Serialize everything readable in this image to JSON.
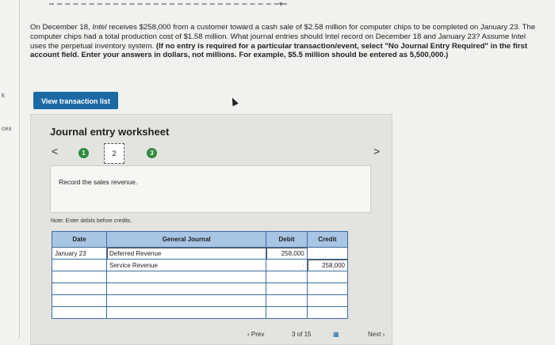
{
  "left_rail": {
    "marks": [
      "k",
      "ces"
    ]
  },
  "question": {
    "part1": "On December 18, ",
    "company_italic": "Intel",
    "part2": " receives $258,000 from a customer toward a cash sale of $2.58 million for computer chips to be completed on January 23. The computer chips had a total production cost of $1.58 million. What journal entries should Intel record on December 18 and January 23? Assume Intel uses the perpetual inventory system. ",
    "bold_instructions": "(If no entry is required for a particular transaction/event, select \"No Journal Entry Required\" in the first account field. Enter your answers in dollars, not millions. For example, $5.5 million should be entered as 5,500,000.)"
  },
  "view_transaction_button": "View transaction list",
  "worksheet": {
    "title": "Journal entry worksheet",
    "prev_arrow": "<",
    "next_arrow": ">",
    "steps": [
      "1",
      "2",
      "3"
    ],
    "current_step": "2",
    "instruction": "Record the sales revenue.",
    "note": "Note: Enter debits before credits.",
    "table": {
      "headers": {
        "date": "Date",
        "account": "General Journal",
        "debit": "Debit",
        "credit": "Credit"
      },
      "rows": [
        {
          "date": "January 23",
          "account": "Deferred Revenue",
          "debit": "258,000",
          "credit": ""
        },
        {
          "date": "",
          "account": "Service Revenue",
          "debit": "",
          "credit": "258,000"
        },
        {
          "date": "",
          "account": "",
          "debit": "",
          "credit": ""
        },
        {
          "date": "",
          "account": "",
          "debit": "",
          "credit": ""
        },
        {
          "date": "",
          "account": "",
          "debit": "",
          "credit": ""
        },
        {
          "date": "",
          "account": "",
          "debit": "",
          "credit": ""
        }
      ]
    }
  },
  "footer": {
    "prev_label": "Prev",
    "page_indicator": "3 of 15",
    "next_label": "Next"
  }
}
